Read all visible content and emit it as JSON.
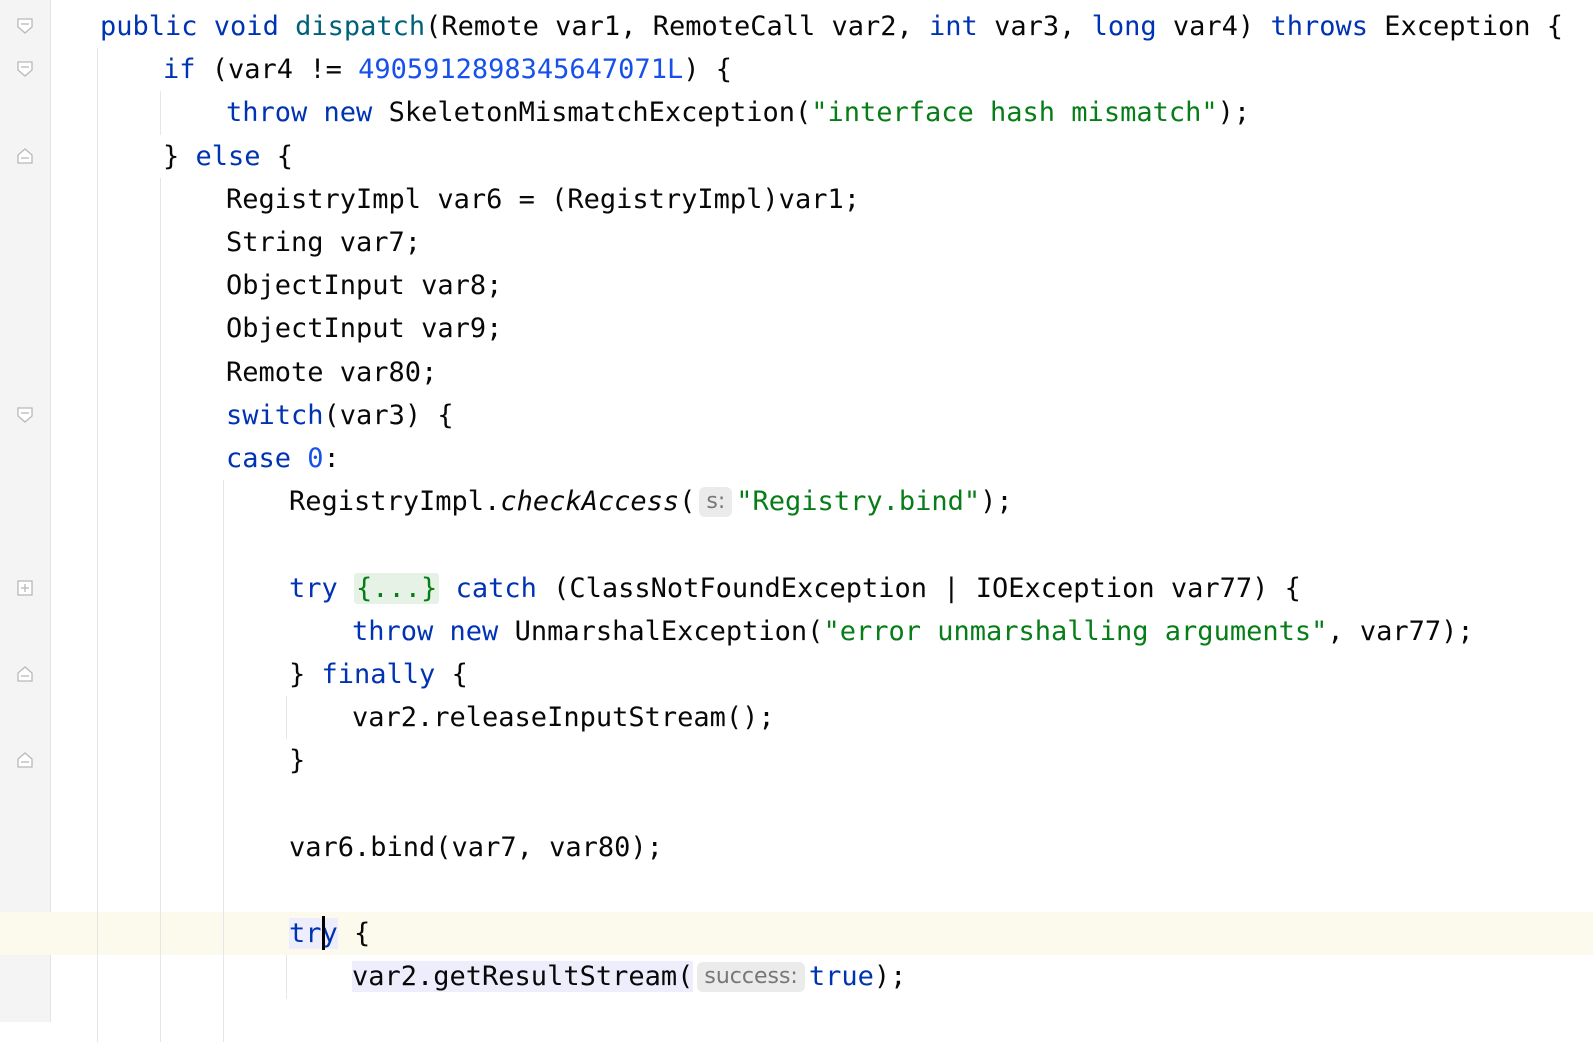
{
  "editor": {
    "lines": [
      {
        "indent": 0,
        "fold": "open",
        "current": false,
        "tokens": [
          {
            "t": "public ",
            "c": "kw"
          },
          {
            "t": "void ",
            "c": "kw"
          },
          {
            "t": "dispatch",
            "c": "fn"
          },
          {
            "t": "(Remote var1, RemoteCall var2, ",
            "c": ""
          },
          {
            "t": "int ",
            "c": "kw"
          },
          {
            "t": "var3, ",
            "c": ""
          },
          {
            "t": "long ",
            "c": "kw"
          },
          {
            "t": "var4) ",
            "c": ""
          },
          {
            "t": "throws ",
            "c": "kw"
          },
          {
            "t": "Exception {",
            "c": ""
          }
        ]
      },
      {
        "indent": 1,
        "fold": "open",
        "current": false,
        "tokens": [
          {
            "t": "if ",
            "c": "kw"
          },
          {
            "t": "(var4 != ",
            "c": ""
          },
          {
            "t": "4905912898345647071L",
            "c": "num"
          },
          {
            "t": ") {",
            "c": ""
          }
        ]
      },
      {
        "indent": 2,
        "fold": "",
        "current": false,
        "tokens": [
          {
            "t": "throw ",
            "c": "kw"
          },
          {
            "t": "new ",
            "c": "kw"
          },
          {
            "t": "SkeletonMismatchException(",
            "c": ""
          },
          {
            "t": "\"interface hash mismatch\"",
            "c": "str"
          },
          {
            "t": ");",
            "c": ""
          }
        ]
      },
      {
        "indent": 1,
        "fold": "close",
        "current": false,
        "tokens": [
          {
            "t": "} ",
            "c": ""
          },
          {
            "t": "else ",
            "c": "kw"
          },
          {
            "t": "{",
            "c": ""
          }
        ]
      },
      {
        "indent": 2,
        "fold": "",
        "current": false,
        "tokens": [
          {
            "t": "RegistryImpl var6 = (RegistryImpl)var1;",
            "c": ""
          }
        ]
      },
      {
        "indent": 2,
        "fold": "",
        "current": false,
        "tokens": [
          {
            "t": "String var7;",
            "c": ""
          }
        ]
      },
      {
        "indent": 2,
        "fold": "",
        "current": false,
        "tokens": [
          {
            "t": "ObjectInput var8;",
            "c": ""
          }
        ]
      },
      {
        "indent": 2,
        "fold": "",
        "current": false,
        "tokens": [
          {
            "t": "ObjectInput var9;",
            "c": ""
          }
        ]
      },
      {
        "indent": 2,
        "fold": "",
        "current": false,
        "tokens": [
          {
            "t": "Remote var80;",
            "c": ""
          }
        ]
      },
      {
        "indent": 2,
        "fold": "open",
        "current": false,
        "tokens": [
          {
            "t": "switch",
            "c": "kw"
          },
          {
            "t": "(var3) {",
            "c": ""
          }
        ]
      },
      {
        "indent": 2,
        "fold": "",
        "current": false,
        "tokens": [
          {
            "t": "case ",
            "c": "kw"
          },
          {
            "t": "0",
            "c": "num"
          },
          {
            "t": ":",
            "c": ""
          }
        ]
      },
      {
        "indent": 3,
        "fold": "",
        "current": false,
        "tokens": [
          {
            "t": "RegistryImpl.",
            "c": ""
          },
          {
            "t": "checkAccess",
            "c": "it"
          },
          {
            "t": "(",
            "c": ""
          },
          {
            "t": "s:",
            "c": "hint"
          },
          {
            "t": "\"Registry.bind\"",
            "c": "str"
          },
          {
            "t": ");",
            "c": ""
          }
        ]
      },
      {
        "indent": 3,
        "fold": "",
        "current": false,
        "tokens": []
      },
      {
        "indent": 3,
        "fold": "plus",
        "current": false,
        "tokens": [
          {
            "t": "try ",
            "c": "kw"
          },
          {
            "t": "{...}",
            "c": "folded"
          },
          {
            "t": " ",
            "c": ""
          },
          {
            "t": "catch ",
            "c": "kw"
          },
          {
            "t": "(ClassNotFoundException | IOException var77) {",
            "c": ""
          }
        ]
      },
      {
        "indent": 4,
        "fold": "",
        "current": false,
        "tokens": [
          {
            "t": "throw ",
            "c": "kw"
          },
          {
            "t": "new ",
            "c": "kw"
          },
          {
            "t": "UnmarshalException(",
            "c": ""
          },
          {
            "t": "\"error unmarshalling arguments\"",
            "c": "str"
          },
          {
            "t": ", var77);",
            "c": ""
          }
        ]
      },
      {
        "indent": 3,
        "fold": "close",
        "current": false,
        "tokens": [
          {
            "t": "} ",
            "c": ""
          },
          {
            "t": "finally ",
            "c": "kw"
          },
          {
            "t": "{",
            "c": ""
          }
        ]
      },
      {
        "indent": 4,
        "fold": "",
        "current": false,
        "tokens": [
          {
            "t": "var2.releaseInputStream();",
            "c": ""
          }
        ]
      },
      {
        "indent": 3,
        "fold": "close",
        "current": false,
        "tokens": [
          {
            "t": "}",
            "c": ""
          }
        ]
      },
      {
        "indent": 3,
        "fold": "",
        "current": false,
        "tokens": []
      },
      {
        "indent": 3,
        "fold": "",
        "current": false,
        "tokens": [
          {
            "t": "var6.bind(var7, var80);",
            "c": ""
          }
        ]
      },
      {
        "indent": 3,
        "fold": "",
        "current": false,
        "tokens": []
      },
      {
        "indent": 3,
        "fold": "open",
        "current": true,
        "tokens": [
          {
            "t": "tr",
            "c": "kw hl-usage"
          },
          {
            "t": "",
            "c": "caret"
          },
          {
            "t": "y",
            "c": "kw hl-usage"
          },
          {
            "t": " {",
            "c": ""
          }
        ]
      },
      {
        "indent": 4,
        "fold": "",
        "current": false,
        "tokens": [
          {
            "t": "var2.getResultStream(",
            "c": "hl-usage"
          },
          {
            "t": "success:",
            "c": "hint"
          },
          {
            "t": "true",
            "c": "kw"
          },
          {
            "t": ");",
            "c": ""
          }
        ]
      }
    ]
  }
}
